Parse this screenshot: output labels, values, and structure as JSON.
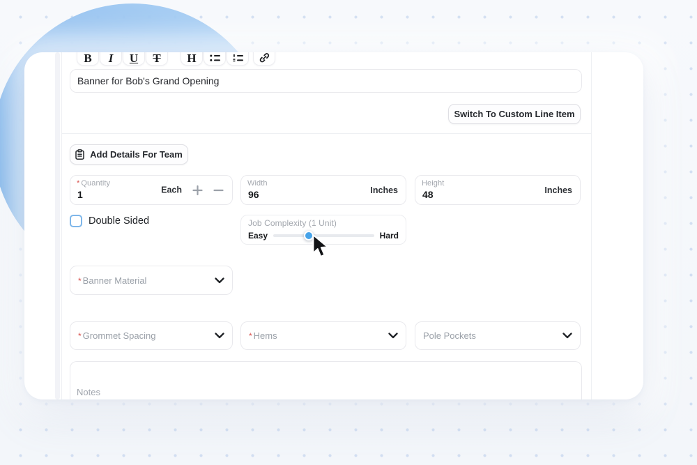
{
  "editor": {
    "toolbar": {
      "bold_glyph": "B",
      "italic_glyph": "I",
      "underline_glyph": "U",
      "strikethrough_glyph": "T",
      "heading_glyph": "H"
    },
    "title_value": "Banner for Bob's Grand Opening"
  },
  "buttons": {
    "switch_custom": "Switch To Custom Line Item",
    "add_details": "Add Details For Team"
  },
  "fields": {
    "quantity": {
      "required": "*",
      "label": "Quantity",
      "value": "1",
      "unit": "Each"
    },
    "width": {
      "label": "Width",
      "value": "96",
      "unit": "Inches"
    },
    "height": {
      "label": "Height",
      "value": "48",
      "unit": "Inches"
    },
    "double_sided": {
      "label": "Double Sided",
      "checked": false
    },
    "job_complexity": {
      "label": "Job Complexity (1 Unit)",
      "min": "Easy",
      "max": "Hard",
      "percent": 35
    },
    "banner_material": {
      "required": "*",
      "label": "Banner Material"
    },
    "grommet_spacing": {
      "required": "*",
      "label": "Grommet Spacing"
    },
    "hems": {
      "required": "*",
      "label": "Hems"
    },
    "pole_pockets": {
      "label": "Pole Pockets"
    },
    "notes": {
      "placeholder": "Notes"
    }
  },
  "colors": {
    "accent_blue": "#47a3e9",
    "checkbox_border": "#7fb7ea",
    "required_red": "#d9534f",
    "blob_blue": "#6aa8e4"
  }
}
